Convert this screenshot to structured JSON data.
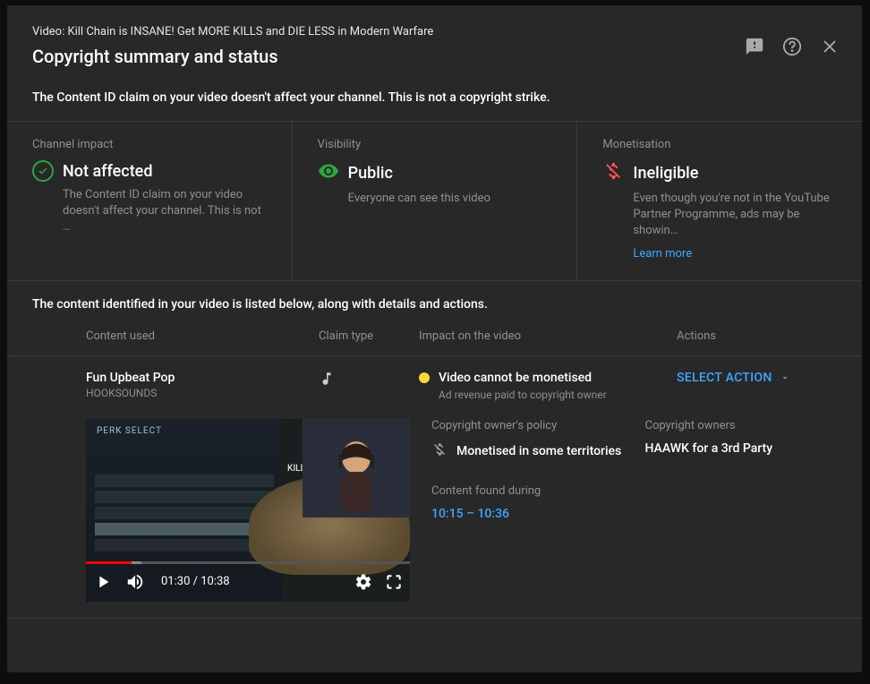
{
  "header": {
    "subtitle": "Video: Kill Chain is INSANE! Get MORE KILLS and DIE LESS in Modern Warfare",
    "title": "Copyright summary and status"
  },
  "banner": "The Content ID claim on your video doesn't affect your channel. This is not a copyright strike.",
  "summary": {
    "channel_impact": {
      "label": "Channel impact",
      "value": "Not affected",
      "desc": "The Content ID claim on your video doesn't affect your channel. This is not …"
    },
    "visibility": {
      "label": "Visibility",
      "value": "Public",
      "desc": "Everyone can see this video"
    },
    "monetisation": {
      "label": "Monetisation",
      "value": "Ineligible",
      "desc": "Even though you're not in the YouTube Partner Programme, ads may be showin…",
      "learn_more": "Learn more"
    }
  },
  "list_intro": "The content identified in your video is listed below, along with details and actions.",
  "columns": {
    "content": "Content used",
    "claim": "Claim type",
    "impact": "Impact on the video",
    "actions": "Actions"
  },
  "claim": {
    "title": "Fun Upbeat Pop",
    "artist": "HOOKSOUNDS",
    "impact_title": "Video cannot be monetised",
    "impact_sub": "Ad revenue paid to copyright owner",
    "select_action": "SELECT ACTION",
    "policy_label": "Copyright owner's policy",
    "policy_value": "Monetised in some territories",
    "owners_label": "Copyright owners",
    "owners_value": "HAAWK for a 3rd Party",
    "found_label": "Content found during",
    "found_value": "10:15 – 10:36"
  },
  "player": {
    "current": "01:30",
    "separator": " / ",
    "duration": "10:38",
    "progress_pct": 14,
    "buffer_pct": 3,
    "perk_label": "PERK SELECT",
    "killchain_label": "KILL CHAIN"
  }
}
